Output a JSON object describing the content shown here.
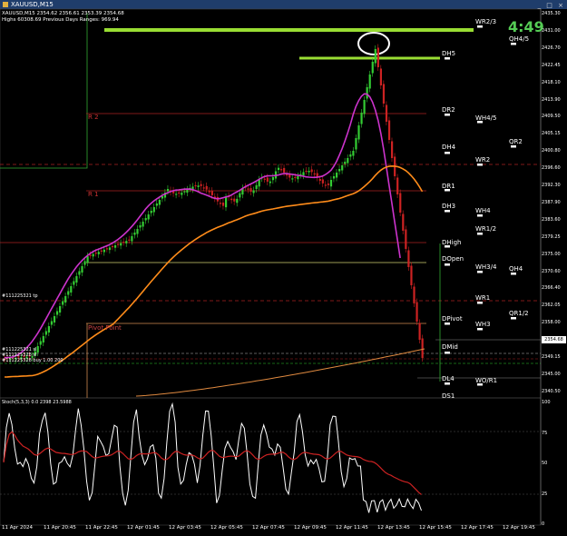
{
  "window": {
    "title": "XAUUSD,M15",
    "buttons": "_ □ ×"
  },
  "header": {
    "line1": "XAUUSD,M15  2354.62 2356.61 2353.39 2354.68",
    "line2": "Highs 60308.69   Previous Days Ranges: 969.94"
  },
  "timer": "4:49",
  "current_price": "2354.68",
  "colors": {
    "bull": "#33cc33",
    "bear": "#cc2222",
    "ma_fast": "#cc33cc",
    "ma_slow": "#ff8c1a",
    "ma_long": "#e08a40",
    "stoch_main": "#ffffff",
    "stoch_signal": "#cc2222",
    "highlight": "#99dd33"
  },
  "left_labels": {
    "r2": "R 2",
    "r1": "R 1",
    "pivot": "Pivot Point",
    "order_tp": "#111225321 tp",
    "order_1": "#111225321 sl",
    "order_2": "#111225328 sl",
    "order_3": "#111225328 buy 1.00 200"
  },
  "level_labels": [
    {
      "text": "WR2/3",
      "color": "#ffffff"
    },
    {
      "text": "DH5",
      "color": "#ffffff"
    },
    {
      "text": "DR2",
      "color": "#ffffff"
    },
    {
      "text": "WH4/5",
      "color": "#ffffff"
    },
    {
      "text": "QR2",
      "color": "#ffffff"
    },
    {
      "text": "DH4",
      "color": "#ffffff"
    },
    {
      "text": "WR2",
      "color": "#ffffff"
    },
    {
      "text": "DR1",
      "color": "#ffffff"
    },
    {
      "text": "DH3",
      "color": "#ffffff"
    },
    {
      "text": "WH4",
      "color": "#ffffff"
    },
    {
      "text": "WR1/2",
      "color": "#ffffff"
    },
    {
      "text": "DHigh",
      "color": "#ffffff"
    },
    {
      "text": "DOpen",
      "color": "#ffffff"
    },
    {
      "text": "WH3/4",
      "color": "#ffffff"
    },
    {
      "text": "QH4",
      "color": "#ffffff"
    },
    {
      "text": "WR1",
      "color": "#ffffff"
    },
    {
      "text": "QR1/2",
      "color": "#ffffff"
    },
    {
      "text": "DPivot",
      "color": "#ffffff"
    },
    {
      "text": "WH3",
      "color": "#ffffff"
    },
    {
      "text": "DMid",
      "color": "#ffffff"
    },
    {
      "text": "DL4",
      "color": "#ffffff"
    },
    {
      "text": "WO/R1",
      "color": "#ffffff"
    },
    {
      "text": "DS1",
      "color": "#ffffff"
    },
    {
      "text": "QH4/5",
      "color": "#ffffff"
    }
  ],
  "price_axis": [
    "2435.30",
    "2431.00",
    "2426.70",
    "2422.45",
    "2418.10",
    "2413.90",
    "2409.50",
    "2405.15",
    "2400.80",
    "2396.60",
    "2392.30",
    "2387.90",
    "2383.60",
    "2379.25",
    "2375.00",
    "2370.60",
    "2366.40",
    "2362.05",
    "2358.00",
    "2353.40",
    "2349.15",
    "2345.00",
    "2340.50"
  ],
  "stoch_axis": [
    "100",
    "75",
    "50",
    "25",
    "0"
  ],
  "stoch_title": "Stoch(5,3,3) 0.0 2398 23.5988",
  "time_axis": [
    "11 Apr 2024",
    "11 Apr 20:45",
    "11 Apr 22:45",
    "12 Apr 01:45",
    "12 Apr 03:45",
    "12 Apr 05:45",
    "12 Apr 07:45",
    "12 Apr 09:45",
    "12 Apr 11:45",
    "12 Apr 13:45",
    "12 Apr 15:45",
    "12 Apr 17:45",
    "12 Apr 19:45"
  ]
}
